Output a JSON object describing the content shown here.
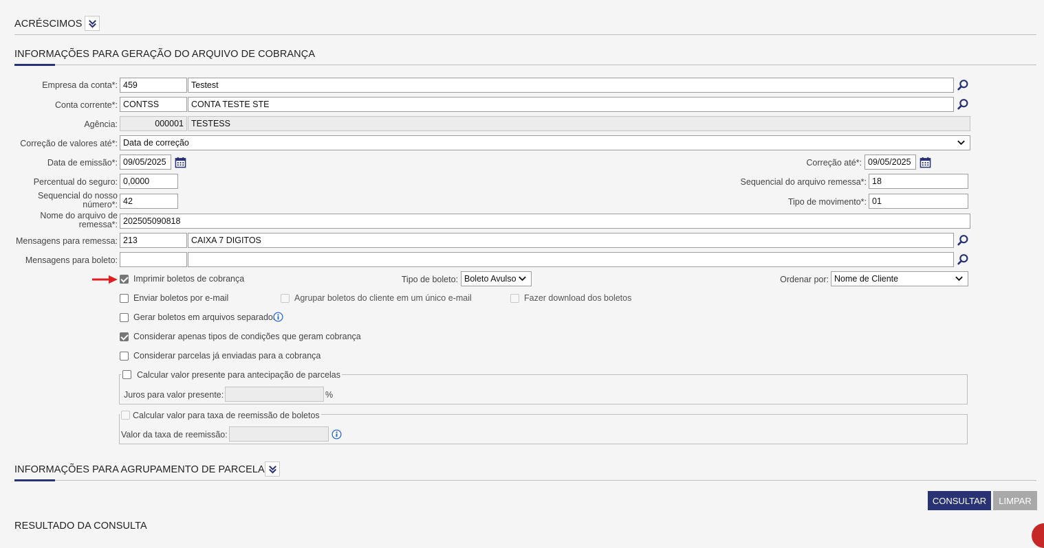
{
  "sections": {
    "acrescimos": "ACRÉSCIMOS",
    "geracao": "INFORMAÇÕES PARA GERAÇÃO DO ARQUIVO DE COBRANÇA",
    "agrupamento": "INFORMAÇÕES PARA AGRUPAMENTO DE PARCELAS",
    "resultado": "RESULTADO DA CONSULTA"
  },
  "form": {
    "empresa": {
      "label": "Empresa da conta*:",
      "code": "459",
      "name": "Testest"
    },
    "conta": {
      "label": "Conta corrente*:",
      "code": "CONTSS",
      "name": "CONTA TESTE STE"
    },
    "agencia": {
      "label": "Agência:",
      "code": "000001",
      "name": "TESTESS"
    },
    "correcao_valores": {
      "label": "Correção de valores até*:",
      "value": "Data de correção"
    },
    "data_emissao": {
      "label": "Data de emissão*:",
      "value": "09/05/2025"
    },
    "correcao_ate": {
      "label": "Correção até*:",
      "value": "09/05/2025"
    },
    "percentual_seguro": {
      "label": "Percentual do seguro:",
      "value": "0,0000"
    },
    "seq_remessa": {
      "label": "Sequencial do arquivo remessa*:",
      "value": "18"
    },
    "seq_nosso_numero": {
      "label": "Sequencial do nosso número*:",
      "value": "42"
    },
    "tipo_movimento": {
      "label": "Tipo de movimento*:",
      "value": "01"
    },
    "nome_arquivo": {
      "label": "Nome do arquivo de remessa*:",
      "value": "202505090818"
    },
    "msg_remessa": {
      "label": "Mensagens para remessa:",
      "code": "213",
      "name": "CAIXA 7 DIGITOS"
    },
    "msg_boleto": {
      "label": "Mensagens para boleto:",
      "code": "",
      "name": ""
    },
    "tipo_boleto": {
      "label": "Tipo de boleto:",
      "value": "Boleto Avulso"
    },
    "ordenar_por": {
      "label": "Ordenar por:",
      "value": "Nome de Cliente"
    }
  },
  "checkboxes": {
    "imprimir": {
      "label": "Imprimir boletos de cobrança",
      "checked": true
    },
    "enviar_email": {
      "label": "Enviar boletos por e-mail",
      "checked": false
    },
    "agrupar_email": {
      "label": "Agrupar boletos do cliente em um único e-mail",
      "checked": false,
      "disabled": true
    },
    "download": {
      "label": "Fazer download dos boletos",
      "checked": false,
      "disabled": true
    },
    "arquivos_separados": {
      "label": "Gerar boletos em arquivos separados",
      "checked": false
    },
    "considerar_tipos": {
      "label": "Considerar apenas tipos de condições que geram cobrança",
      "checked": true
    },
    "considerar_parcelas": {
      "label": "Considerar parcelas já enviadas para a cobrança",
      "checked": false
    }
  },
  "valor_presente": {
    "legend": "Calcular valor presente para antecipação de parcelas",
    "juros_label": "Juros para valor presente:",
    "juros_value": "",
    "unit": "%"
  },
  "reemissao": {
    "legend": "Calcular valor para taxa de reemissão de boletos",
    "taxa_label": "Valor da taxa de reemissão:",
    "taxa_value": ""
  },
  "buttons": {
    "consultar": "CONSULTAR",
    "limpar": "LIMPAR"
  },
  "colors": {
    "accent": "#283274",
    "primary_button": "#283274",
    "disabled_button": "#a9a9a9",
    "arrow": "#e02020"
  }
}
